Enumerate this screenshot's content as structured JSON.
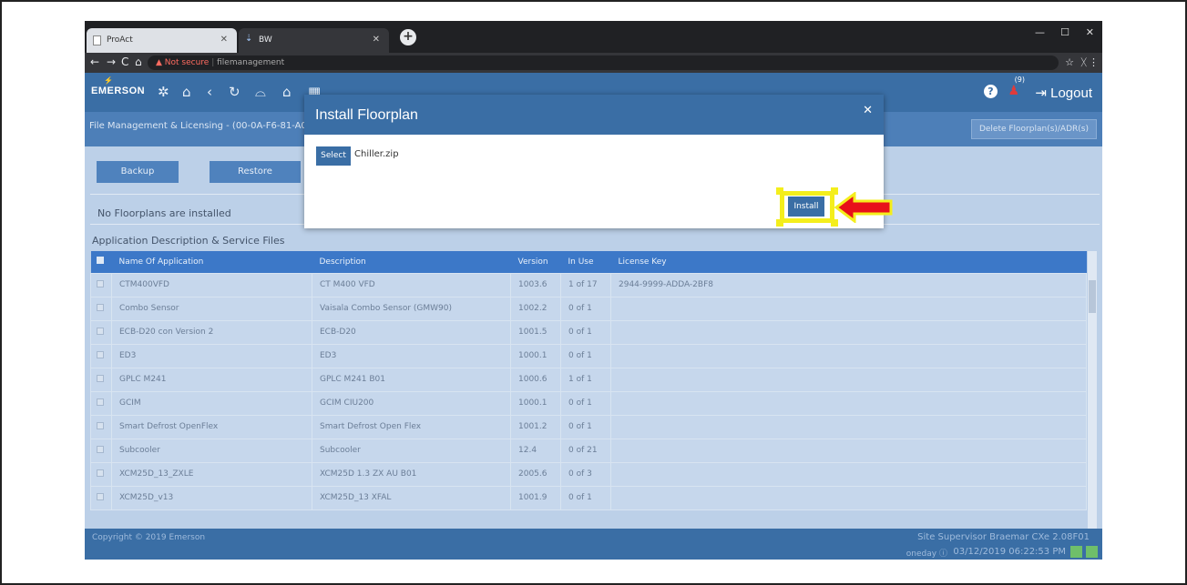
{
  "browser": {
    "tabs": [
      {
        "label": "ProAct"
      },
      {
        "label": "BW"
      }
    ],
    "security_label": "Not secure",
    "url": "filemanagement"
  },
  "app": {
    "brand": "EMERSON",
    "notifications_count": "(9)",
    "logout_label": "Logout",
    "subtitle": "File Management & Licensing - (00-0A-F6-81-A0",
    "delete_button": "Delete Floorplan(s)/ADR(s)",
    "backup_button": "Backup",
    "restore_button": "Restore",
    "no_floorplans": "No Floorplans are installed",
    "section_title": "Application Description & Service Files"
  },
  "table": {
    "columns": [
      "Name Of Application",
      "Description",
      "Version",
      "In Use",
      "License Key"
    ],
    "rows": [
      [
        "CTM400VFD",
        "CT M400 VFD",
        "1003.6",
        "1 of 17",
        "2944-9999-ADDA-2BF8"
      ],
      [
        "Combo Sensor",
        "Vaisala Combo Sensor (GMW90)",
        "1002.2",
        "0 of 1",
        ""
      ],
      [
        "ECB-D20 con Version 2",
        "ECB-D20",
        "1001.5",
        "0 of 1",
        ""
      ],
      [
        "ED3",
        "ED3",
        "1000.1",
        "0 of 1",
        ""
      ],
      [
        "GPLC M241",
        "GPLC M241 B01",
        "1000.6",
        "1 of 1",
        ""
      ],
      [
        "GCIM",
        "GCIM CIU200",
        "1000.1",
        "0 of 1",
        ""
      ],
      [
        "Smart Defrost OpenFlex",
        "Smart Defrost Open Flex",
        "1001.2",
        "0 of 1",
        ""
      ],
      [
        "Subcooler",
        "Subcooler",
        "12.4",
        "0 of 21",
        ""
      ],
      [
        "XCM25D_13_ZXLE",
        "XCM25D 1.3 ZX AU B01",
        "2005.6",
        "0 of 3",
        ""
      ],
      [
        "XCM25D_v13",
        "XCM25D_13 XFAL",
        "1001.9",
        "0 of 1",
        ""
      ]
    ]
  },
  "footer": {
    "copyright": "Copyright © 2019 Emerson",
    "site": "Site Supervisor Braemar CXe 2.08F01",
    "oneday": "oneday",
    "datetime": "03/12/2019 06:22:53 PM"
  },
  "modal": {
    "title": "Install Floorplan",
    "select_label": "Select",
    "file_name": "Chiller.zip",
    "install_label": "Install"
  },
  "colors": {
    "accent": "#3a6ea5",
    "highlight": "#f4ee1c",
    "arrow": "#e8101a"
  }
}
